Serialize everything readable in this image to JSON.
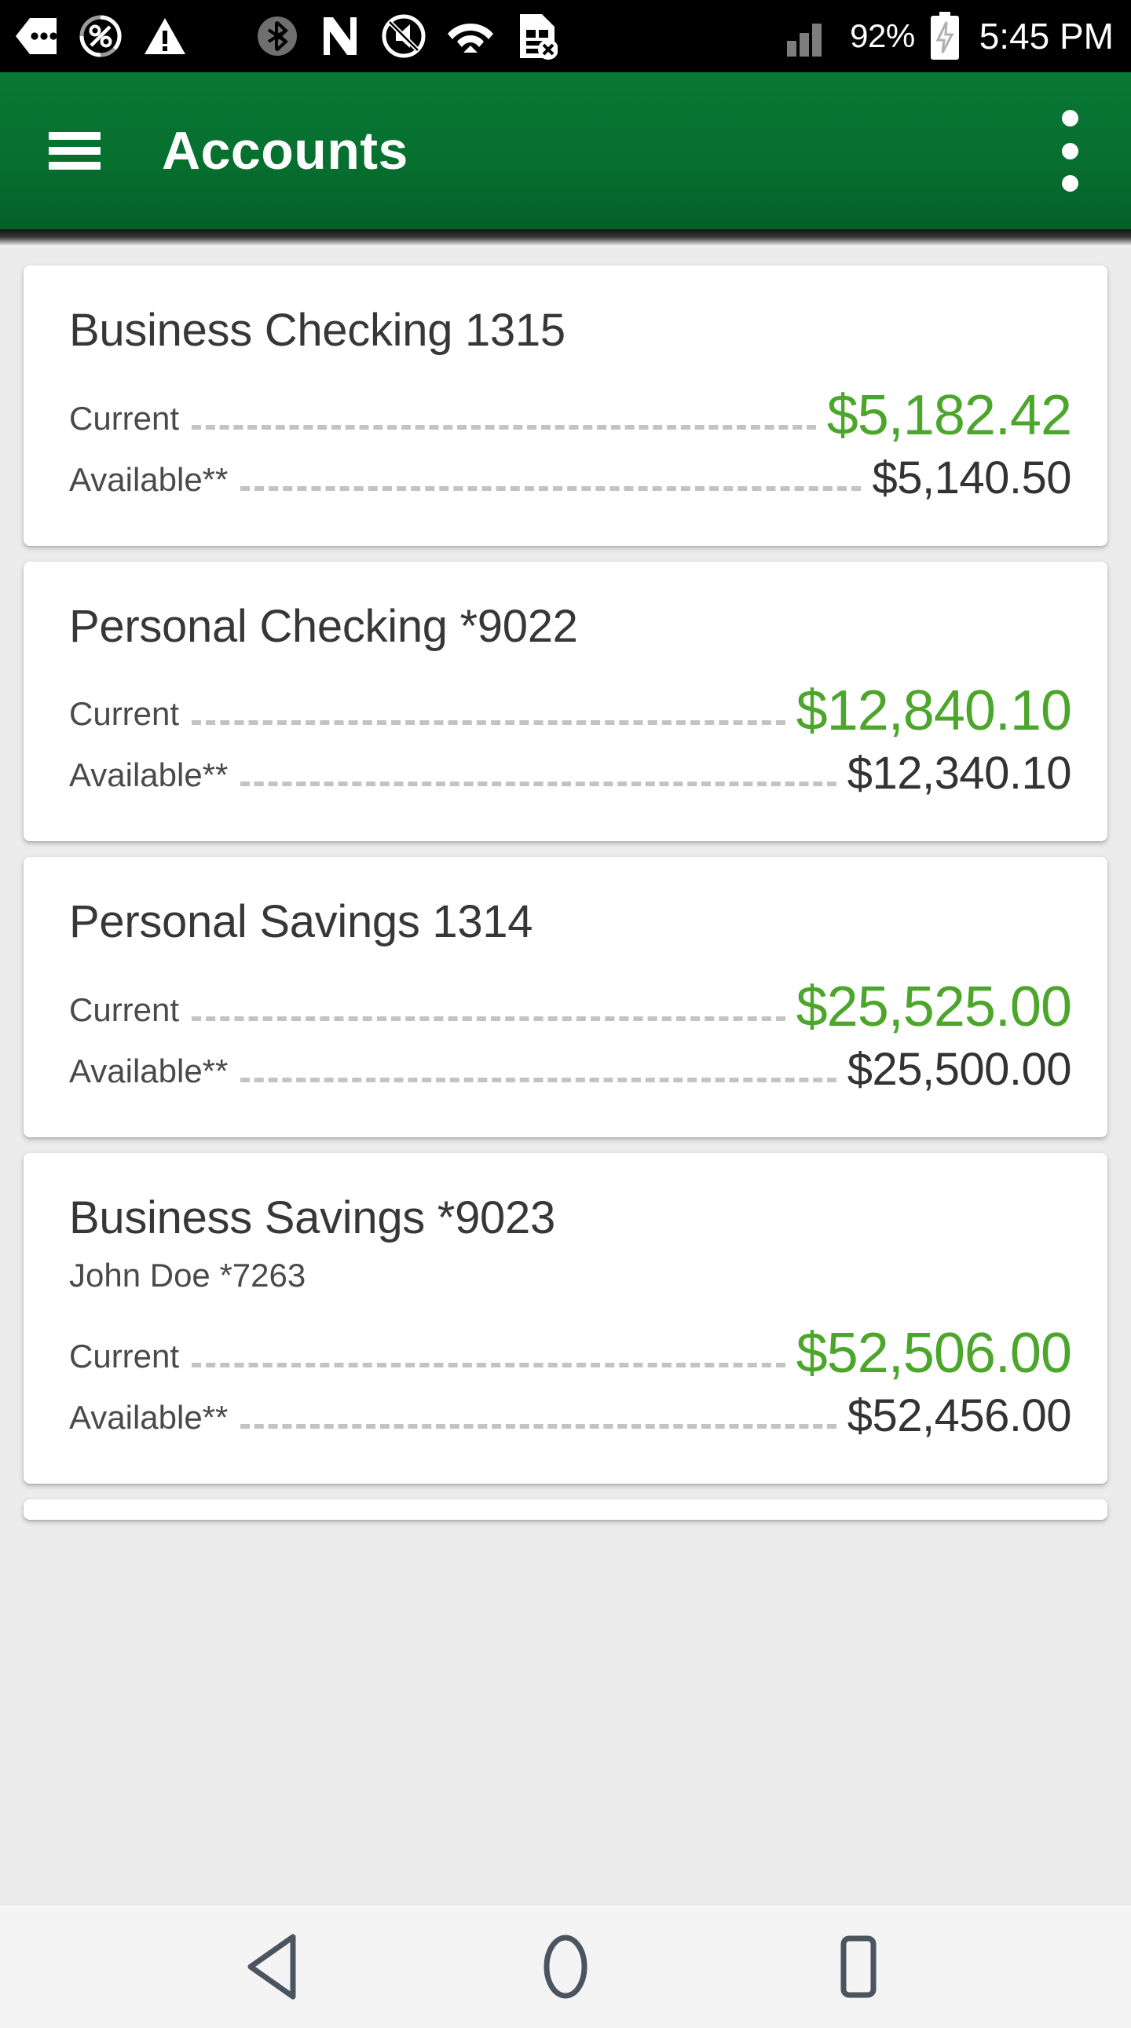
{
  "status_bar": {
    "icons": [
      "more-notifications-icon",
      "data-saver-percent-icon",
      "warning-triangle-icon",
      "bluetooth-icon",
      "nfc-icon",
      "ringer-off-icon",
      "wifi-icon",
      "sim-card-error-icon",
      "cellular-signal-icon"
    ],
    "battery_percent": "92%",
    "battery_state": "charging-battery-icon",
    "clock": "5:45 PM"
  },
  "app_bar": {
    "menu_icon": "hamburger-menu-icon",
    "title": "Accounts",
    "overflow_icon": "overflow-menu-icon"
  },
  "colors": {
    "app_bar_green": "#06702F",
    "current_balance_green": "#4CA62B",
    "available_balance_black": "#333333",
    "page_background": "#ececec",
    "card_background": "#ffffff",
    "nav_bar_background": "#f4f4f4",
    "nav_icon": "#4a5560"
  },
  "labels": {
    "current": "Current",
    "available": "Available**"
  },
  "accounts": [
    {
      "title": "Business Checking 1315",
      "subtitle": "",
      "current_label": "Current",
      "current_value": "$5,182.42",
      "available_label": "Available**",
      "available_value": "$5,140.50"
    },
    {
      "title": "Personal Checking *9022",
      "subtitle": "",
      "current_label": "Current",
      "current_value": "$12,840.10",
      "available_label": "Available**",
      "available_value": "$12,340.10"
    },
    {
      "title": "Personal Savings 1314",
      "subtitle": "",
      "current_label": "Current",
      "current_value": "$25,525.00",
      "available_label": "Available**",
      "available_value": "$25,500.00"
    },
    {
      "title": "Business Savings *9023",
      "subtitle": "John Doe *7263",
      "current_label": "Current",
      "current_value": "$52,506.00",
      "available_label": "Available**",
      "available_value": "$52,456.00"
    }
  ],
  "nav_bar": {
    "back": "back-triangle-icon",
    "home": "home-circle-icon",
    "recents": "recents-square-icon"
  }
}
